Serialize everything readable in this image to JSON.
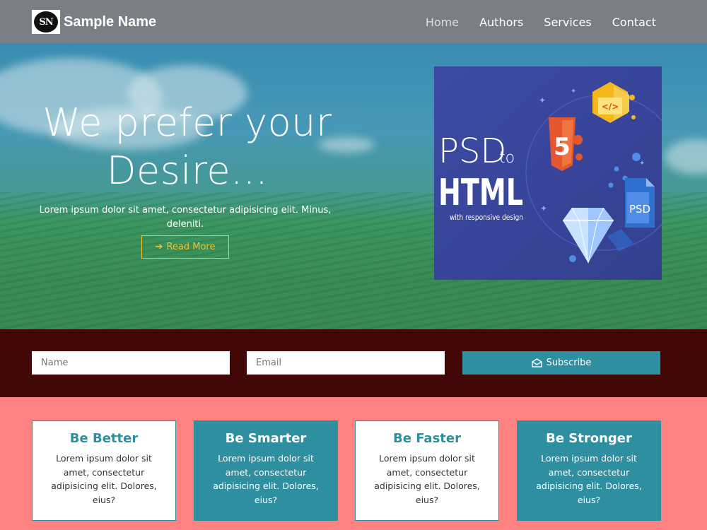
{
  "nav": {
    "logo_text": "SN",
    "brand": "Sample Name",
    "links": [
      "Home",
      "Authors",
      "Services",
      "Contact"
    ]
  },
  "hero": {
    "heading": "We prefer your Desire...",
    "subtext": "Lorem ipsum dolor sit amet, consectetur adipisicing elit. Minus, deleniti.",
    "button": "Read More",
    "image": {
      "line1": "PSD",
      "to": "to",
      "line2": "HTML",
      "caption": "with responsive design",
      "html5": "5",
      "code": "</>",
      "file": "PSD"
    }
  },
  "subscribe": {
    "name_placeholder": "Name",
    "email_placeholder": "Email",
    "button": "Subscribe"
  },
  "cards": [
    {
      "title": "Be Better",
      "text": "Lorem ipsum dolor sit amet, consectetur adipisicing elit. Dolores, eius?"
    },
    {
      "title": "Be Smarter",
      "text": "Lorem ipsum dolor sit amet, consectetur adipisicing elit. Dolores, eius?"
    },
    {
      "title": "Be Faster",
      "text": "Lorem ipsum dolor sit amet, consectetur adipisicing elit. Dolores, eius?"
    },
    {
      "title": "Be Stronger",
      "text": "Lorem ipsum dolor sit amet, consectetur adipisicing elit. Dolores, eius?"
    }
  ],
  "colors": {
    "navbar": "#7a7f86",
    "accent": "#2e8fa1",
    "gold": "#f2c230",
    "subscribe_bg": "#420707",
    "page_bg": "#ff8282"
  }
}
